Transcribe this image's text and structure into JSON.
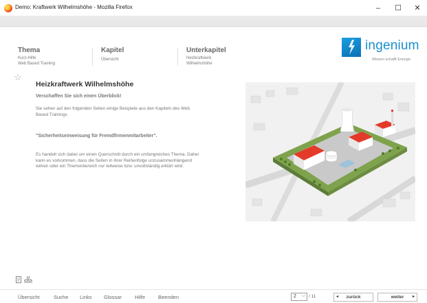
{
  "window": {
    "title": "Demo: Kraftwerk Wilhelmshöhe - Mozilla Firefox",
    "minimize": "–",
    "maximize": "☐",
    "close": "✕"
  },
  "header": {
    "columns": [
      {
        "title": "Thema",
        "lines": [
          "Kurz-Hilfe",
          "Web Based Training"
        ]
      },
      {
        "title": "Kapitel",
        "lines": [
          "Übersicht"
        ]
      },
      {
        "title": "Unterkapitel",
        "lines": [
          "Heizkraftwerk",
          "Wilhelmshöhe"
        ]
      }
    ]
  },
  "logo": {
    "name": "ingenium",
    "tagline": "Wissen schafft Energie",
    "color": "#1b8fd0"
  },
  "content": {
    "title": "Heizkraftwerk Wilhelmshöhe",
    "intro": "Verschaffen Sie sich einen Überblick!",
    "para1": "Sie sehen auf den folgenden Seiten einige Beispiele aus den Kapiteln des Web Based Trainings",
    "quote": "\"Sicherheitseinweisung für Fremdfirmenmitarbeiter\".",
    "para2": "Es handelt sich dabei um einen Querschnitt durch ein umfangreiches Thema. Daher kann es vorkommen, dass die Seiten in ihrer Reihenfolge unzusammenhängend wirken oder ein Themenbereich nur teilweise bzw. unvollständig erklärt wird."
  },
  "footer": {
    "nav": [
      "Übersicht",
      "Suche",
      "Links",
      "Glossar",
      "Hilfe",
      "Beenden"
    ],
    "page_current": "2",
    "page_total": "/ 11",
    "back_label": "zurück",
    "next_label": "weiter"
  },
  "icons": {
    "bookmark": "star-outline-icon",
    "page_list": "document-icon",
    "sitemap": "sitemap-icon"
  }
}
